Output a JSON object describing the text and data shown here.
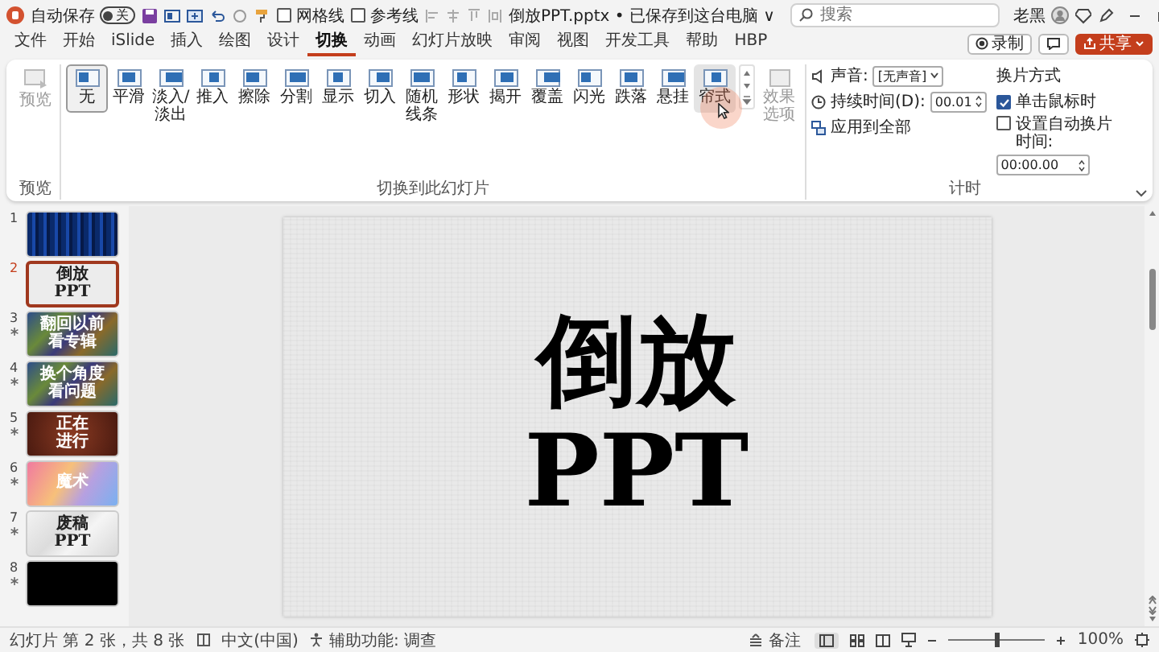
{
  "title_bar": {
    "autosave": {
      "label": "自动保存",
      "on": false,
      "state": "关"
    },
    "checkboxes": [
      {
        "label": "网格线",
        "checked": false
      },
      {
        "label": "参考线",
        "checked": false
      }
    ],
    "document_title": "倒放PPT.pptx • 已保存到这台电脑 ∨",
    "search": {
      "placeholder": "搜索"
    },
    "user": "老黑"
  },
  "ribbon_tabs": [
    {
      "label": "文件",
      "selected": false
    },
    {
      "label": "开始",
      "selected": false
    },
    {
      "label": "iSlide",
      "selected": false
    },
    {
      "label": "插入",
      "selected": false
    },
    {
      "label": "绘图",
      "selected": false
    },
    {
      "label": "设计",
      "selected": false
    },
    {
      "label": "切换",
      "selected": true
    },
    {
      "label": "动画",
      "selected": false
    },
    {
      "label": "幻灯片放映",
      "selected": false
    },
    {
      "label": "审阅",
      "selected": false
    },
    {
      "label": "视图",
      "selected": false
    },
    {
      "label": "开发工具",
      "selected": false
    },
    {
      "label": "帮助",
      "selected": false
    },
    {
      "label": "HBP",
      "selected": false
    }
  ],
  "tab_actions": {
    "record": "录制",
    "share": "共享"
  },
  "ribbon": {
    "preview": {
      "label": "预览",
      "disabled": true
    },
    "transitions": [
      {
        "label": "无",
        "selected": true,
        "hovered": false
      },
      {
        "label": "平滑",
        "selected": false,
        "hovered": false
      },
      {
        "label": "淡入/淡出",
        "selected": false,
        "hovered": false
      },
      {
        "label": "推入",
        "selected": false,
        "hovered": false
      },
      {
        "label": "擦除",
        "selected": false,
        "hovered": false
      },
      {
        "label": "分割",
        "selected": false,
        "hovered": false
      },
      {
        "label": "显示",
        "selected": false,
        "hovered": false
      },
      {
        "label": "切入",
        "selected": false,
        "hovered": false
      },
      {
        "label": "随机线条",
        "selected": false,
        "hovered": false
      },
      {
        "label": "形状",
        "selected": false,
        "hovered": false
      },
      {
        "label": "揭开",
        "selected": false,
        "hovered": false
      },
      {
        "label": "覆盖",
        "selected": false,
        "hovered": false
      },
      {
        "label": "闪光",
        "selected": false,
        "hovered": false
      },
      {
        "label": "跌落",
        "selected": false,
        "hovered": false
      },
      {
        "label": "悬挂",
        "selected": false,
        "hovered": false
      },
      {
        "label": "帘式",
        "selected": false,
        "hovered": true
      }
    ],
    "effect_options": {
      "label": "效果选项",
      "disabled": true
    },
    "group_labels": [
      "预览",
      "切换到此幻灯片",
      "计时"
    ],
    "timing": {
      "sound_label": "声音:",
      "sound_value": "[无声音]",
      "duration_label": "持续时间(D):",
      "duration_value": "00.01",
      "apply_all": "应用到全部",
      "advance_title": "换片方式",
      "on_click": {
        "label": "单击鼠标时",
        "checked": true
      },
      "after": {
        "label": "设置自动换片时间:",
        "checked": false,
        "value": "00:00.00"
      }
    }
  },
  "slides": [
    {
      "number": "1",
      "kind": "curtain",
      "animated": false,
      "selected": false
    },
    {
      "number": "2",
      "kind": "paper",
      "animated": false,
      "selected": true,
      "text_lines": [
        "倒放",
        "PPT"
      ]
    },
    {
      "number": "3",
      "kind": "mosaic",
      "animated": true,
      "selected": false,
      "text_lines": [
        "翻回以前看专辑"
      ]
    },
    {
      "number": "4",
      "kind": "mosaic",
      "animated": true,
      "selected": false,
      "text_lines": [
        "换个角度看问题"
      ]
    },
    {
      "number": "5",
      "kind": "brown",
      "animated": true,
      "selected": false,
      "text_lines": [
        "正在",
        "进行"
      ]
    },
    {
      "number": "6",
      "kind": "rainbow",
      "animated": true,
      "selected": false,
      "text_lines": [
        "魔术"
      ]
    },
    {
      "number": "7",
      "kind": "crumpled",
      "animated": true,
      "selected": false,
      "text_lines": [
        "废稿",
        "PPT"
      ]
    },
    {
      "number": "8",
      "kind": "black",
      "animated": true,
      "selected": false
    }
  ],
  "canvas": {
    "title_lines": [
      "倒放",
      "PPT"
    ]
  },
  "status_bar": {
    "slide_info": "幻灯片 第 2 张，共 8 张",
    "language": "中文(中国)",
    "accessibility": "辅助功能: 调查",
    "notes": "备注",
    "zoom_slider": {
      "level": 0.5
    },
    "zoom": "100%"
  }
}
